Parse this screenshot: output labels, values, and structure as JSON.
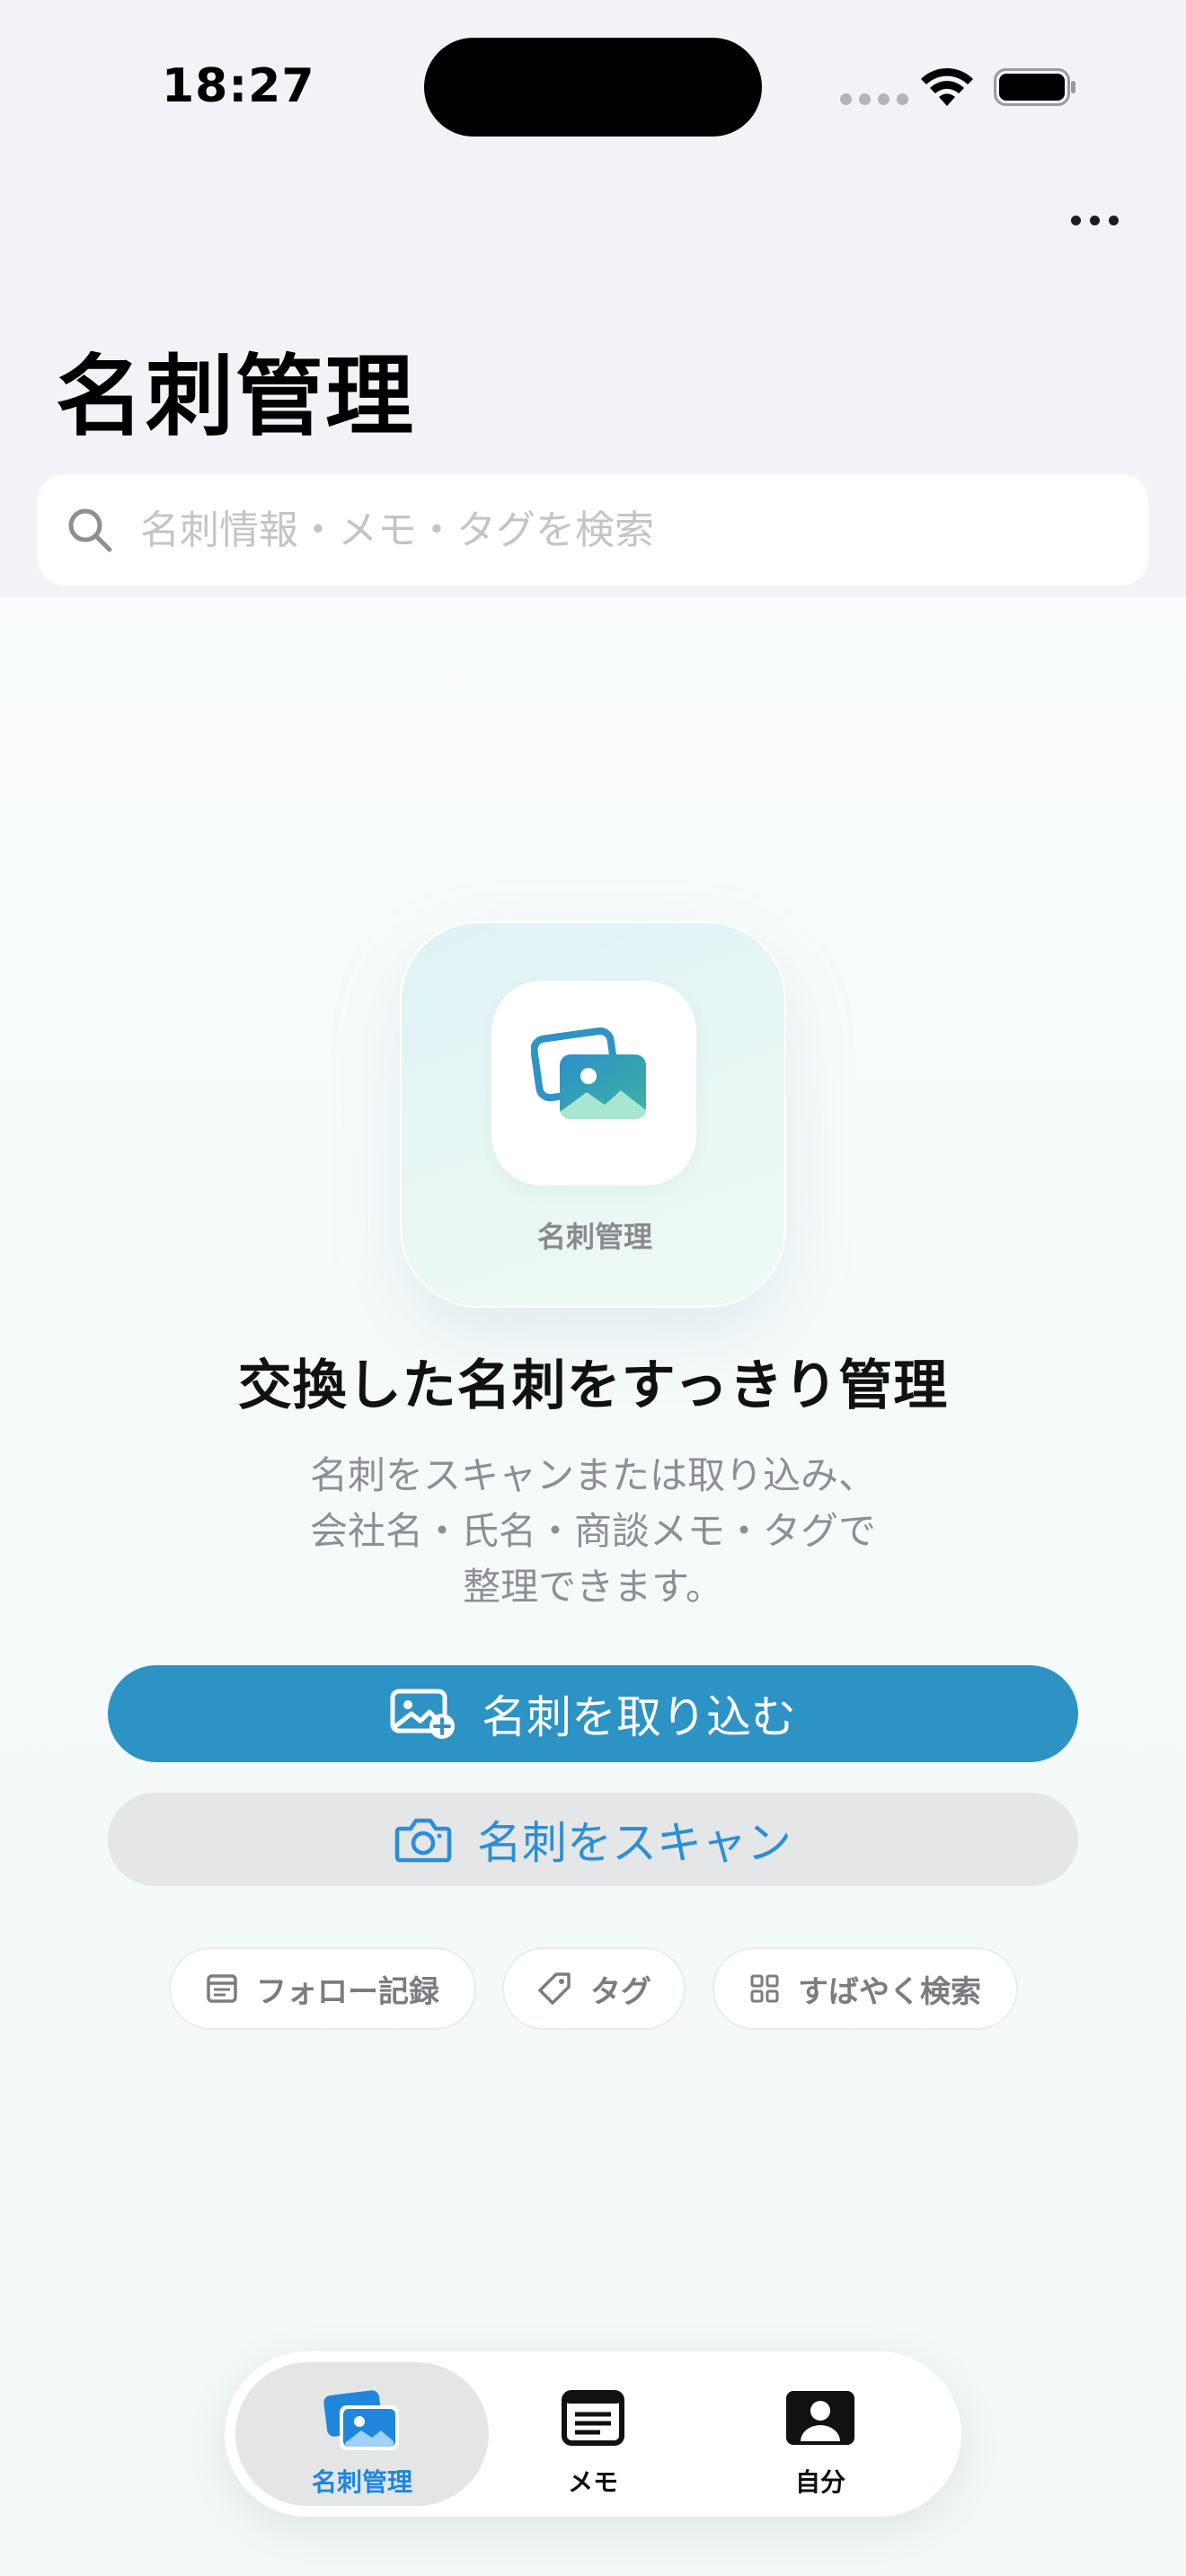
{
  "status_bar": {
    "time": "18:27"
  },
  "header": {
    "title": "名刺管理",
    "more_label": "…"
  },
  "search": {
    "placeholder": "名刺情報・メモ・タグを検索"
  },
  "hero": {
    "card_label": "名刺管理",
    "headline": "交換した名刺をすっきり管理",
    "description_lines": [
      "名刺をスキャンまたは取り込み、",
      "会社名・氏名・商談メモ・タグで",
      "整理できます。"
    ]
  },
  "actions": {
    "import_label": "名刺を取り込む",
    "scan_label": "名刺をスキャン"
  },
  "chips": [
    {
      "label": "フォロー記録",
      "icon": "note-icon"
    },
    {
      "label": "タグ",
      "icon": "tag-icon"
    },
    {
      "label": "すばやく検索",
      "icon": "grid-icon"
    }
  ],
  "tabbar": {
    "tabs": [
      {
        "label": "名刺管理",
        "icon": "cards-icon",
        "active": true
      },
      {
        "label": "メモ",
        "icon": "memo-icon",
        "active": false
      },
      {
        "label": "自分",
        "icon": "person-icon",
        "active": false
      }
    ]
  },
  "colors": {
    "accent": "#2d93c4",
    "link": "#2a8fd6",
    "tab_active": "#1f86dc"
  }
}
